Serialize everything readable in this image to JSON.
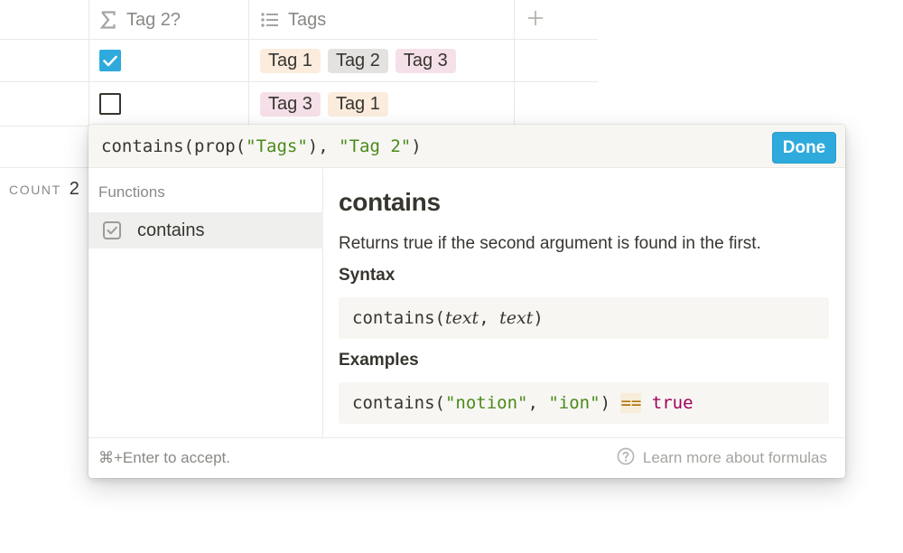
{
  "table": {
    "columns": [
      {
        "label": "Tag 2?",
        "icon": "sigma-icon"
      },
      {
        "label": "Tags",
        "icon": "multi-select-icon"
      }
    ],
    "add_column_icon": "plus-icon",
    "rows": [
      {
        "checked": true,
        "tags": [
          {
            "label": "Tag 1",
            "color": "#fbecdd"
          },
          {
            "label": "Tag 2",
            "color": "#e3e2e0"
          },
          {
            "label": "Tag 3",
            "color": "#f5e0e9"
          }
        ]
      },
      {
        "checked": false,
        "tags": [
          {
            "label": "Tag 3",
            "color": "#f5e0e9"
          },
          {
            "label": "Tag 1",
            "color": "#fbecdd"
          }
        ]
      }
    ],
    "count_label": "COUNT",
    "count_value": "2"
  },
  "popup": {
    "formula": {
      "prefix": "contains(prop(",
      "arg1": "\"Tags\"",
      "mid": "), ",
      "arg2": "\"Tag 2\"",
      "suffix": ")"
    },
    "done_label": "Done",
    "functions_header": "Functions",
    "selected_function": "contains",
    "selected_function_icon": "checkbox-icon",
    "detail": {
      "title": "contains",
      "description": "Returns true if the second argument is found in the first.",
      "syntax_header": "Syntax",
      "syntax": {
        "fn": "contains(",
        "a1": "text",
        "sep": ", ",
        "a2": "text",
        "end": ")"
      },
      "examples_header": "Examples",
      "example": {
        "fn": "contains(",
        "a1": "\"notion\"",
        "sep": ", ",
        "a2": "\"ion\"",
        "close": ") ",
        "op": "==",
        "sp": " ",
        "result": "true"
      }
    },
    "footer": {
      "hint": "⌘+Enter to accept.",
      "learn_more": "Learn more about formulas",
      "help_icon": "question-circle-icon"
    }
  },
  "colors": {
    "accent": "#2eaadc",
    "string": "#4b8a1a",
    "keyword": "#a0005a"
  }
}
